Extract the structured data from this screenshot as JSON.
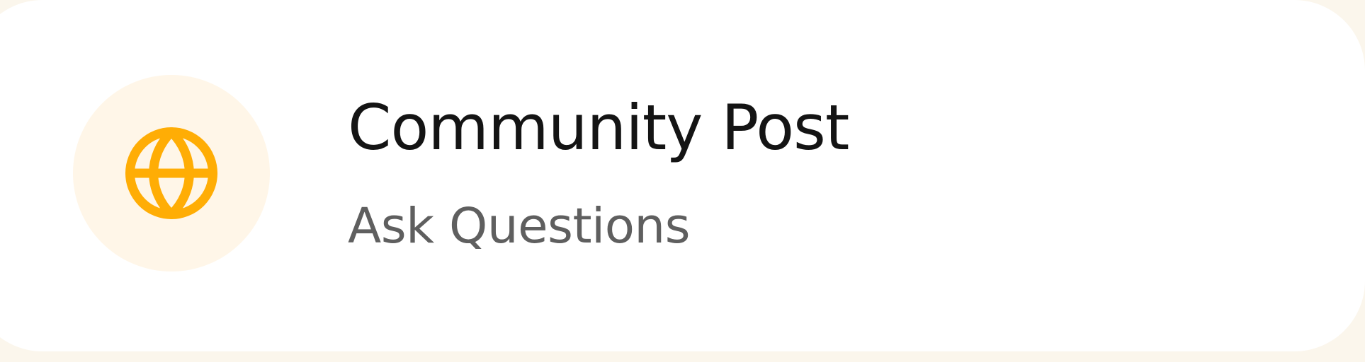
{
  "card": {
    "title": "Community Post",
    "subtitle": "Ask Questions",
    "icon": "globe-icon"
  },
  "colors": {
    "accent": "#ffad05",
    "icon_background": "#fff6e8",
    "title": "#141414",
    "subtitle": "#5f5f5f",
    "page_background": "#fbf6ec"
  }
}
